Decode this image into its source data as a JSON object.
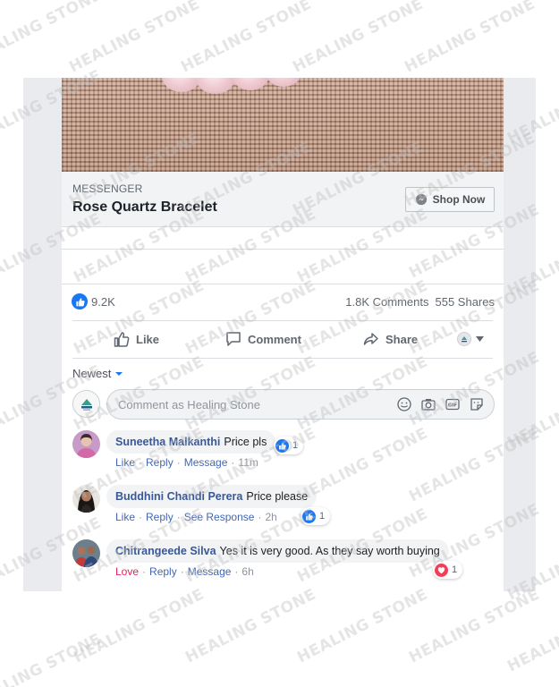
{
  "watermark": "HEALING STONE",
  "link_preview": {
    "source": "MESSENGER",
    "title": "Rose Quartz Bracelet",
    "cta_label": "Shop Now",
    "cta_icon": "messenger-icon"
  },
  "reactions": {
    "like_count": "9.2K",
    "comments_count": "1.8K Comments",
    "shares_count": "555 Shares"
  },
  "actions": {
    "like_label": "Like",
    "comment_label": "Comment",
    "share_label": "Share"
  },
  "comments_sort": {
    "label": "Newest"
  },
  "composer": {
    "placeholder": "Comment as Healing Stone"
  },
  "comments": [
    {
      "name": "Suneetha Malkanthi",
      "text": "Price pls",
      "reaction_action": "Like",
      "actions": [
        "Reply",
        "Message"
      ],
      "time": "11m",
      "reaction_type": "like",
      "reaction_count": "1"
    },
    {
      "name": "Buddhini Chandi Perera",
      "text": "Price please",
      "reaction_action": "Like",
      "actions": [
        "Reply",
        "See Response"
      ],
      "time": "2h",
      "reaction_type": "like",
      "reaction_count": "1"
    },
    {
      "name": "Chitrangeede Silva",
      "text": "Yes it is very good. As they say worth buying",
      "reaction_action": "Love",
      "actions": [
        "Reply",
        "Message"
      ],
      "time": "6h",
      "reaction_type": "love",
      "reaction_count": "1"
    }
  ],
  "colors": {
    "facebook_blue": "#1877f2",
    "name_link": "#385898",
    "love_red": "#e0245e"
  }
}
